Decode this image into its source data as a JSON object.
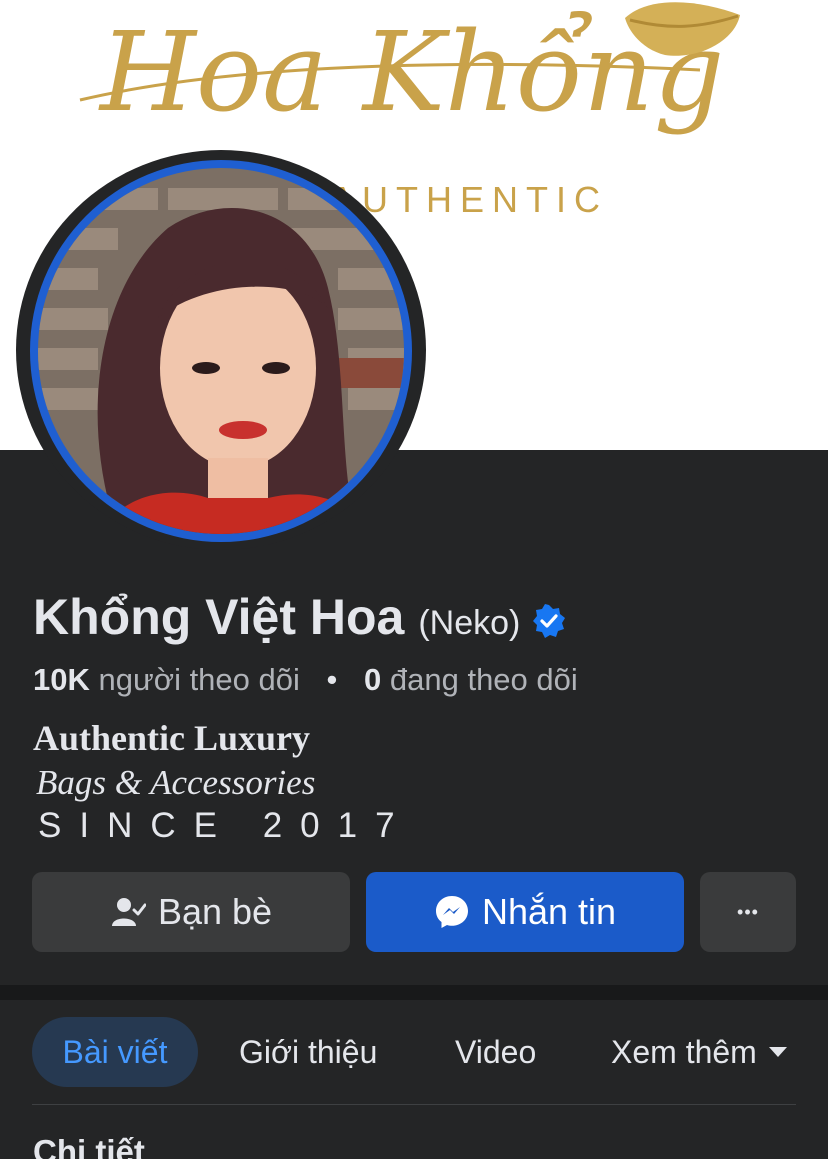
{
  "cover": {
    "brand_script": "Hoa Khổng",
    "brand_sub": "AUTHENTIC",
    "accent_gold": "#c9a24a",
    "icon": "lips-icon"
  },
  "profile": {
    "name": "Khổng Việt Hoa",
    "nickname": "(Neko)",
    "verified_icon": "verified-badge-icon",
    "followers_count": "10K",
    "followers_label": "người theo dõi",
    "separator": "•",
    "following_count": "0",
    "following_label": "đang theo dõi",
    "bio_line1": "Authentic Luxury",
    "bio_line2": "Bags & Accessories",
    "bio_line3": "SINCE 2017"
  },
  "actions": {
    "friends_label": "Bạn bè",
    "friends_icon": "friend-check-icon",
    "message_label": "Nhắn tin",
    "message_icon": "messenger-icon",
    "more_label": "•••",
    "accent_blue": "#1b5bc9"
  },
  "tabs": {
    "posts": "Bài viết",
    "about": "Giới thiệu",
    "video": "Video",
    "more": "Xem thêm"
  },
  "section": {
    "title": "Chi tiết"
  }
}
